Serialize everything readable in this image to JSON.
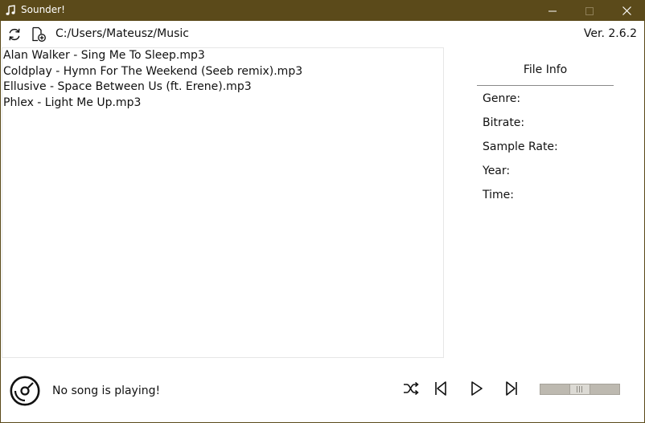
{
  "window": {
    "title": "Sounder!",
    "titlebar_color": "#5b4a1a",
    "icons": {
      "app": "music-note-icon",
      "minimize": "minimize-icon",
      "maximize": "maximize-icon",
      "close": "close-icon"
    }
  },
  "toolbar": {
    "icons": {
      "refresh": "refresh-icon",
      "add_folder": "add-folder-icon"
    },
    "path": "C:/Users/Mateusz/Music",
    "version": "Ver. 2.6.2"
  },
  "songs": [
    "Alan Walker - Sing Me To Sleep.mp3",
    "Coldplay - Hymn For The Weekend (Seeb remix).mp3",
    "Ellusive - Space Between Us (ft. Erene).mp3",
    "Phlex - Light Me Up.mp3"
  ],
  "file_info": {
    "title": "File Info",
    "fields": [
      {
        "label": "Genre:",
        "value": ""
      },
      {
        "label": "Bitrate:",
        "value": ""
      },
      {
        "label": "Sample Rate:",
        "value": ""
      },
      {
        "label": "Year:",
        "value": ""
      },
      {
        "label": "Time:",
        "value": ""
      }
    ]
  },
  "player": {
    "status": "No song is playing!",
    "icons": {
      "disc": "disc-icon",
      "shuffle": "shuffle-icon",
      "previous": "previous-icon",
      "play": "play-icon",
      "next": "next-icon"
    },
    "volume_fraction": 0.5
  }
}
